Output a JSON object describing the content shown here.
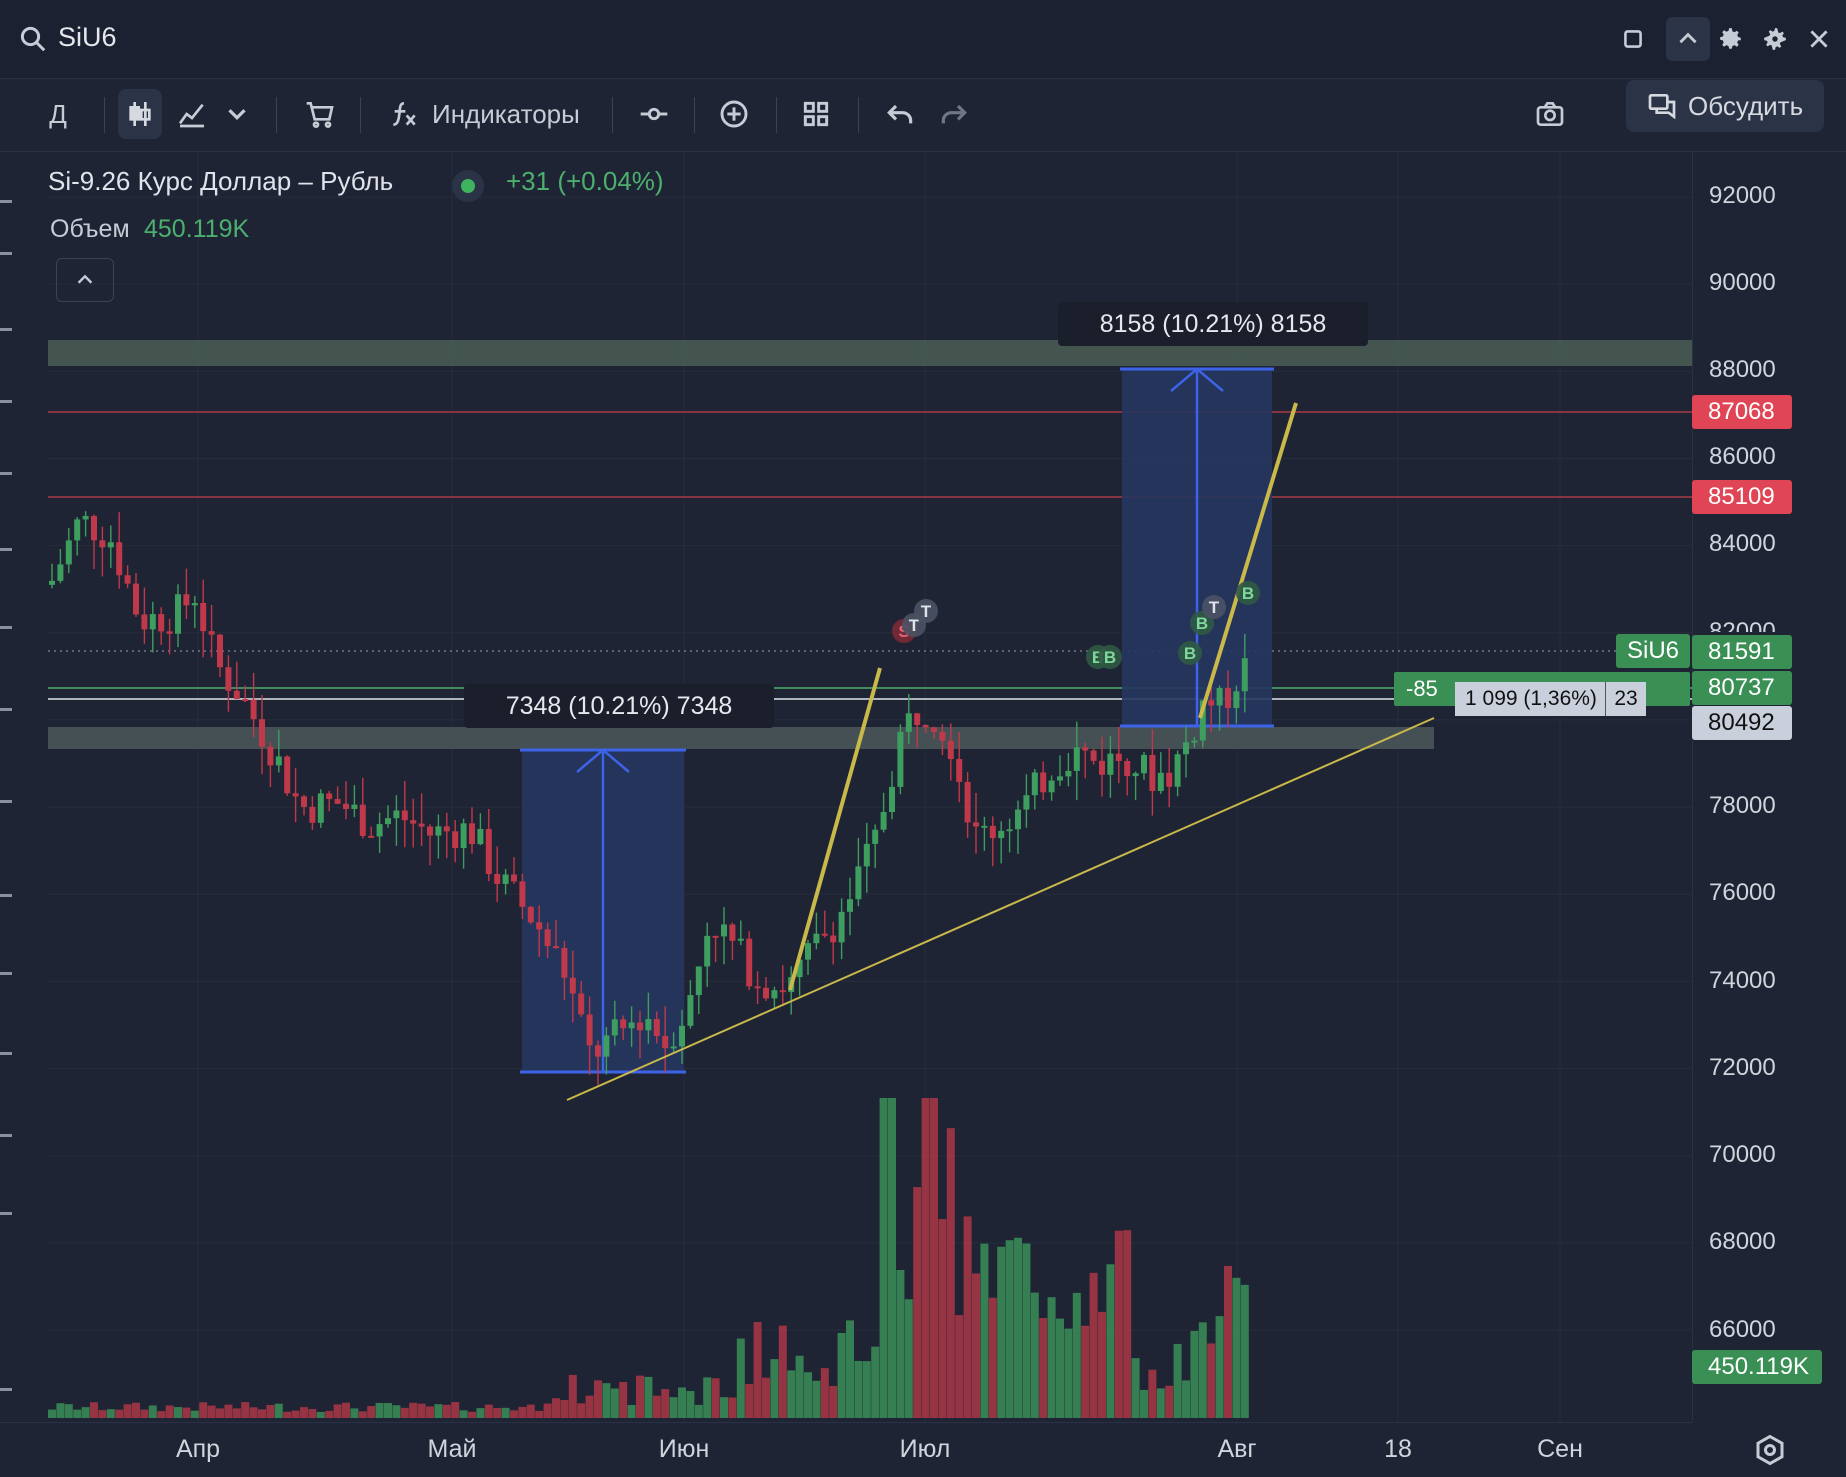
{
  "header": {
    "ticker": "SiU6",
    "icons": [
      "search-icon",
      "square-icon",
      "chevron-up-icon",
      "gear-icon",
      "advanced-gear-icon",
      "close-icon"
    ]
  },
  "toolbar": {
    "interval": "Д",
    "indicators_label": "Индикаторы",
    "discuss_label": "Обсудить",
    "icons": [
      "candles-icon",
      "area-chart-icon",
      "chevron-down-icon",
      "cart-icon",
      "fx-icon",
      "crosshair-dot-icon",
      "plus-circle-icon",
      "grid-icon",
      "undo-icon",
      "redo-icon",
      "camera-icon",
      "chat-icon"
    ]
  },
  "legend": {
    "title": "Si-9.26 Курс Доллар – Рубль",
    "change": "+31 (+0.04%)",
    "volume_label": "Объем",
    "volume_value": "450.119K"
  },
  "price_axis": {
    "ticks": [
      "92000",
      "90000",
      "88000",
      "86000",
      "84000",
      "82000",
      "78000",
      "76000",
      "74000",
      "72000",
      "70000",
      "68000",
      "66000"
    ],
    "tags": {
      "p87068": "87068",
      "p85109": "85109",
      "p81591": "81591",
      "p80737": "80737",
      "p80492": "80492",
      "volume": "450.119K"
    }
  },
  "time_axis": {
    "ticks": [
      "Апр",
      "Май",
      "Июн",
      "Июл",
      "Авг",
      "18",
      "Сен"
    ]
  },
  "overlays": {
    "measure_upper": "8158 (10.21%) 8158",
    "measure_lower": "7348 (10.21%) 7348",
    "symbol_tag": "SiU6",
    "order_text": "-85",
    "range_text": "1 099 (1,36%)",
    "range_count": "23"
  },
  "colors": {
    "background": "#1e2433",
    "up": "#3d9e5f",
    "down": "#c0394a",
    "red_tag": "#e04555",
    "green_tag": "#3a8f55",
    "gray_tag": "#c9d0dc",
    "measure_fill": "#26365e",
    "measure_line": "#3c63e8",
    "trend_yellow": "#c9b84a"
  },
  "chart_data": {
    "type": "candlestick",
    "x": [
      "Апр",
      "Май",
      "Июн",
      "Июл",
      "Авг",
      "18",
      "Сен"
    ],
    "ylim": [
      66000,
      92000
    ],
    "markers": [
      "S",
      "T",
      "T",
      "B",
      "B",
      "B",
      "B",
      "T",
      "B"
    ],
    "levels": [
      87068,
      85109,
      81591,
      80737,
      80492
    ],
    "volume_last": "450.119K"
  }
}
